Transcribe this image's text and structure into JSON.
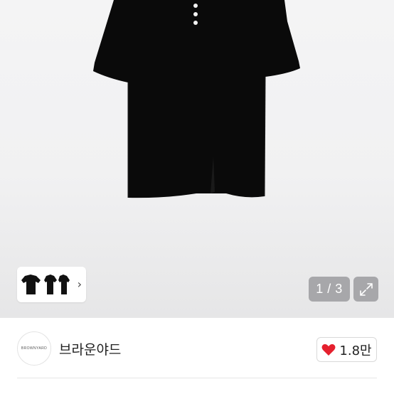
{
  "gallery": {
    "pager_text": "1 / 3",
    "expand_icon": "expand-arrows-icon",
    "thumbnail_chevron": "›"
  },
  "store": {
    "name": "브라운야드",
    "logo_text": "BROWNYARD"
  },
  "like": {
    "icon": "heart-icon",
    "icon_color": "#e5202e",
    "count": "1.8만"
  }
}
